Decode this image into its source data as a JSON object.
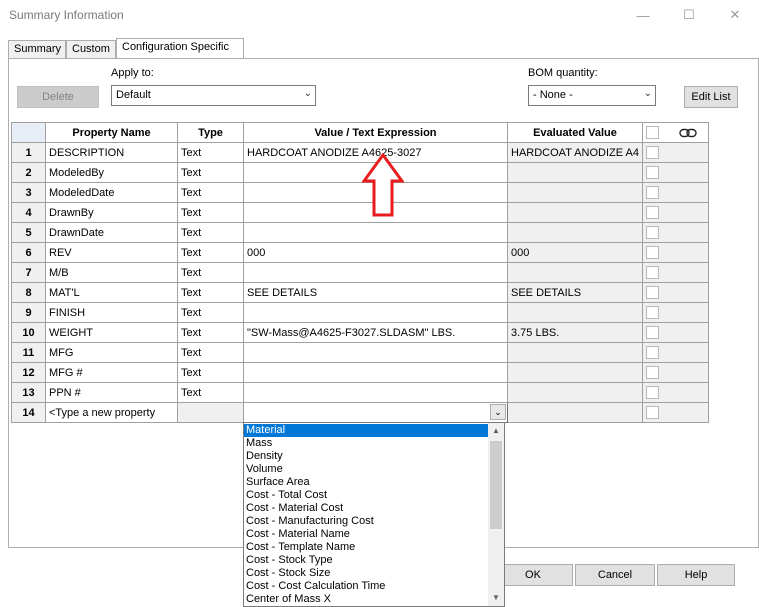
{
  "window": {
    "title": "Summary Information"
  },
  "tabs": [
    "Summary",
    "Custom",
    "Configuration Specific"
  ],
  "apply_to": {
    "label": "Apply to:",
    "value": "Default"
  },
  "bom_quantity": {
    "label": "BOM quantity:",
    "value": "- None -"
  },
  "buttons": {
    "delete": "Delete",
    "edit_list": "Edit List",
    "ok": "OK",
    "cancel": "Cancel",
    "help": "Help"
  },
  "table": {
    "headers": [
      "Property Name",
      "Type",
      "Value / Text Expression",
      "Evaluated Value"
    ],
    "rows": [
      {
        "num": "1",
        "name": "DESCRIPTION",
        "type": "Text",
        "value": "HARDCOAT ANODIZE A4625-3027",
        "evaluated": "HARDCOAT ANODIZE A4"
      },
      {
        "num": "2",
        "name": "ModeledBy",
        "type": "Text",
        "value": "",
        "evaluated": ""
      },
      {
        "num": "3",
        "name": "ModeledDate",
        "type": "Text",
        "value": "",
        "evaluated": ""
      },
      {
        "num": "4",
        "name": "DrawnBy",
        "type": "Text",
        "value": "",
        "evaluated": ""
      },
      {
        "num": "5",
        "name": "DrawnDate",
        "type": "Text",
        "value": "",
        "evaluated": ""
      },
      {
        "num": "6",
        "name": "REV",
        "type": "Text",
        "value": "000",
        "evaluated": "000"
      },
      {
        "num": "7",
        "name": "M/B",
        "type": "Text",
        "value": "",
        "evaluated": ""
      },
      {
        "num": "8",
        "name": "MAT'L",
        "type": "Text",
        "value": "SEE DETAILS",
        "evaluated": "SEE DETAILS"
      },
      {
        "num": "9",
        "name": "FINISH",
        "type": "Text",
        "value": "",
        "evaluated": ""
      },
      {
        "num": "10",
        "name": "WEIGHT",
        "type": "Text",
        "value": "\"SW-Mass@A4625-F3027.SLDASM\" LBS.",
        "evaluated": "3.75 LBS."
      },
      {
        "num": "11",
        "name": "MFG",
        "type": "Text",
        "value": "",
        "evaluated": ""
      },
      {
        "num": "12",
        "name": "MFG #",
        "type": "Text",
        "value": "",
        "evaluated": ""
      },
      {
        "num": "13",
        "name": "PPN #",
        "type": "Text",
        "value": "",
        "evaluated": ""
      }
    ],
    "new_row": {
      "num": "14",
      "name": "<Type a new property",
      "type": "",
      "value": "",
      "evaluated": ""
    }
  },
  "dropdown_options": [
    "Material",
    "Mass",
    "Density",
    "Volume",
    "Surface Area",
    "Cost - Total Cost",
    "Cost - Material Cost",
    "Cost - Manufacturing Cost",
    "Cost - Material Name",
    "Cost - Template Name",
    "Cost - Stock Type",
    "Cost - Stock Size",
    "Cost - Cost Calculation Time",
    "Center of Mass X"
  ],
  "selected_option": "Material",
  "colors": {
    "annotation_arrow": "#e81c1c",
    "selection": "#0078d7"
  }
}
